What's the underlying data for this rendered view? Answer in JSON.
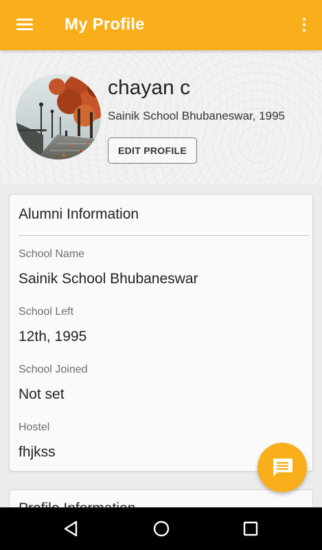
{
  "appbar": {
    "title": "My Profile",
    "menu_icon": "hamburger-menu-icon",
    "overflow_icon": "more-vert-icon",
    "color": "#f9ae1b"
  },
  "profile": {
    "name": "chayan c",
    "school_year": "Sainik School Bhubaneswar, 1995",
    "edit_label": "EDIT PROFILE"
  },
  "alumni_card": {
    "title": "Alumni Information",
    "fields": [
      {
        "label": "School Name",
        "value": "Sainik School Bhubaneswar"
      },
      {
        "label": "School Left",
        "value": "12th, 1995"
      },
      {
        "label": "School Joined",
        "value": "Not set"
      },
      {
        "label": "Hostel",
        "value": "fhjkss"
      }
    ]
  },
  "profile_card": {
    "title": "Profile Information"
  },
  "fab": {
    "icon": "chat-message-icon"
  },
  "navbar": {
    "back_icon": "back-triangle-icon",
    "home_icon": "home-circle-icon",
    "recents_icon": "recents-square-icon"
  }
}
